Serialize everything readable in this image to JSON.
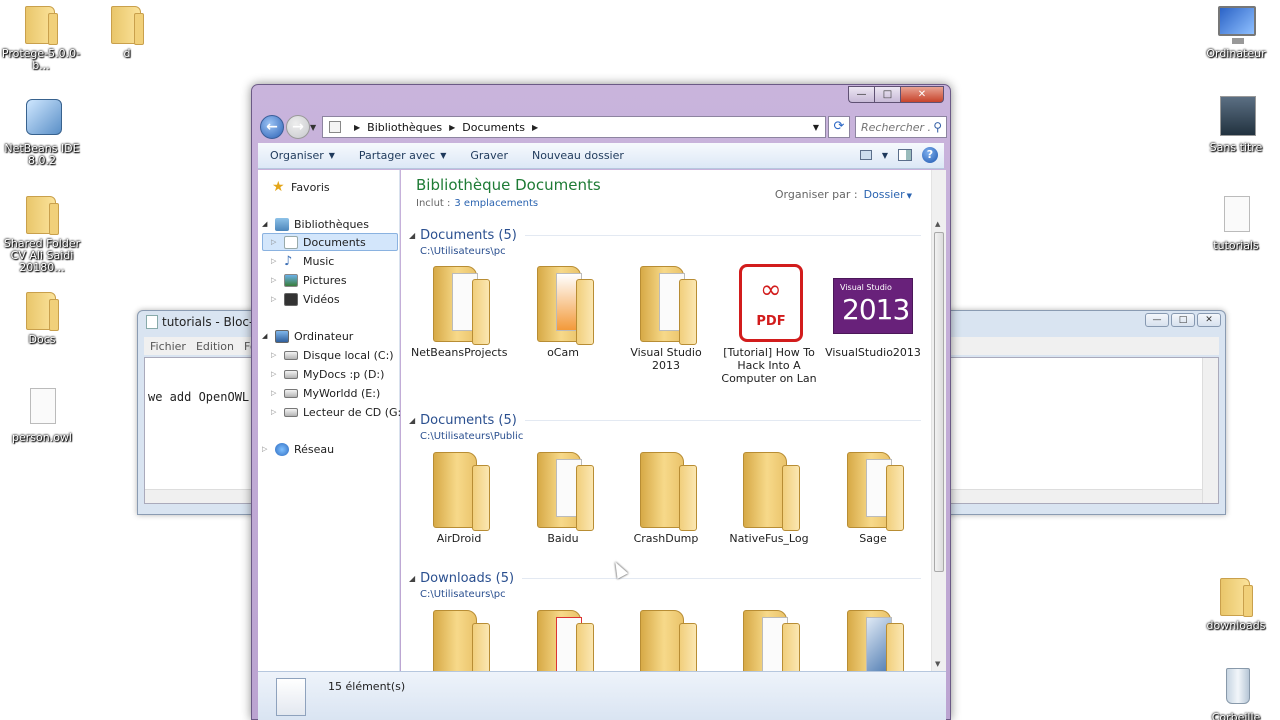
{
  "desktop": {
    "icons": [
      {
        "label": "Protege-5.0.0-b..."
      },
      {
        "label": "d"
      },
      {
        "label": "NetBeans IDE 8.0.2"
      },
      {
        "label": "Shared Folder CV Ali Saidi 20180..."
      },
      {
        "label": "Docs"
      },
      {
        "label": "person.owl"
      },
      {
        "label": "Ordinateur"
      },
      {
        "label": "Sans titre"
      },
      {
        "label": "tutorials"
      },
      {
        "label": "downloads"
      },
      {
        "label": "Corbeille"
      }
    ]
  },
  "notepad": {
    "title": "tutorials - Bloc-notes",
    "menu": [
      "Fichier",
      "Edition",
      "Format"
    ],
    "text": "we add OpenOWL."
  },
  "explorer": {
    "controls": {
      "minimize": "—",
      "maximize": "□",
      "close": "✕"
    },
    "breadcrumb": [
      "Bibliothèques",
      "Documents"
    ],
    "search_placeholder": "Rechercher ...",
    "toolbar": {
      "organize": "Organiser",
      "share": "Partager avec",
      "burn": "Graver",
      "new_folder": "Nouveau dossier"
    },
    "nav": {
      "favorites": "Favoris",
      "libraries": "Bibliothèques",
      "lib_items": [
        "Documents",
        "Music",
        "Pictures",
        "Vidéos"
      ],
      "computer": "Ordinateur",
      "drives": [
        "Disque local (C:)",
        "MyDocs :p (D:)",
        "MyWorldd (E:)",
        "Lecteur de CD (G:)"
      ],
      "network": "Réseau"
    },
    "library": {
      "title": "Bibliothèque Documents",
      "includes_label": "Inclut :",
      "includes_link": "3 emplacements",
      "arrange_label": "Organiser par :",
      "arrange_value": "Dossier"
    },
    "groups": [
      {
        "header": "Documents (5)",
        "path": "C:\\Utilisateurs\\pc",
        "items": [
          "NetBeansProjects",
          "oCam",
          "Visual Studio 2013",
          "[Tutorial] How To Hack Into A Computer on Lan",
          "VisualStudio2013"
        ]
      },
      {
        "header": "Documents (5)",
        "path": "C:\\Utilisateurs\\Public",
        "items": [
          "AirDroid",
          "Baidu",
          "CrashDump",
          "NativeFus_Log",
          "Sage"
        ]
      },
      {
        "header": "Downloads (5)",
        "path": "C:\\Utilisateurs\\pc",
        "items": [
          "",
          "",
          "",
          "",
          ""
        ]
      }
    ],
    "pdf_badge": "PDF",
    "vs_badge_small": "Visual Studio",
    "vs_badge_year": "2013",
    "status": "15 élément(s)"
  }
}
